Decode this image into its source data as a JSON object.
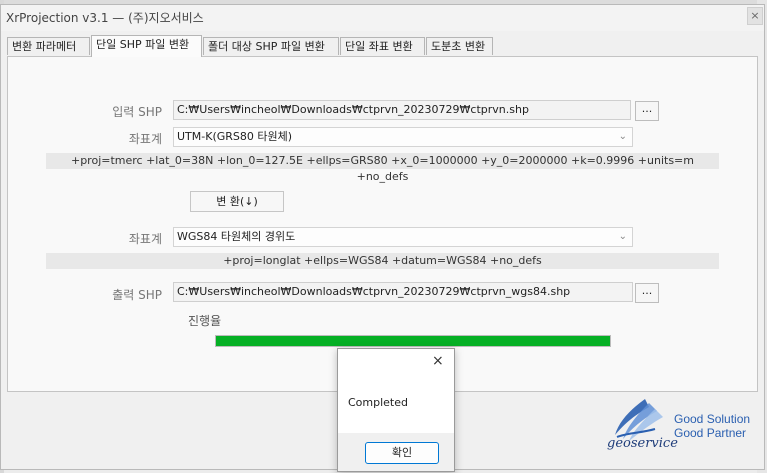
{
  "window": {
    "title": "XrProjection v3.1 — (주)지오서비스",
    "close": "×"
  },
  "tabs": [
    "변환 파라메터",
    "단일 SHP 파일 변환",
    "폴더 대상 SHP 파일 변환",
    "단일 좌표 변환",
    "도분초 변환"
  ],
  "form": {
    "input_label": "입력 SHP",
    "input_path": "C:₩Users₩incheol₩Downloads₩ctprvn_20230729₩ctprvn.shp",
    "browse": "...",
    "crs_label": "좌표계",
    "source_crs": "UTM-K(GRS80 타원체)",
    "source_proj": "+proj=tmerc +lat_0=38N +lon_0=127.5E +ellps=GRS80 +x_0=1000000 +y_0=2000000 +k=0.9996 +units=m +no_defs",
    "convert_button": "변 환(↓)",
    "target_crs_label": "좌표계",
    "target_crs": "WGS84 타원체의 경위도",
    "target_proj": "+proj=longlat +ellps=WGS84 +datum=WGS84 +no_defs",
    "output_label": "출력 SHP",
    "output_path": "C:₩Users₩incheol₩Downloads₩ctprvn_20230729₩ctprvn_wgs84.shp",
    "browse2": "...",
    "progress_label": "진행율",
    "progress_value": 1.0
  },
  "logo": {
    "brand": "geoservice",
    "line1": "Good Solution",
    "line2": "Good Partner"
  },
  "dialog": {
    "message": "Completed",
    "ok": "확인",
    "close": "×"
  },
  "colors": {
    "progress": "#06b025",
    "accent": "#0078d4",
    "logo_blue": "#2a5fb0"
  }
}
